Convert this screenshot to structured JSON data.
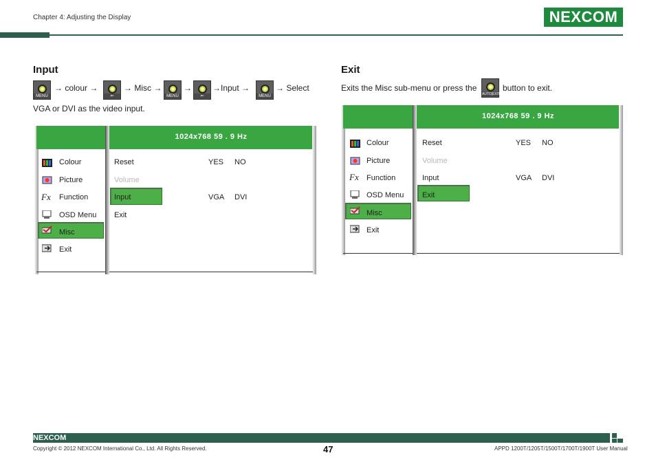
{
  "header": {
    "chapter": "Chapter 4: Adjusting the Display",
    "logo_text": "NEXCOM"
  },
  "input_section": {
    "title": "Input",
    "steps": [
      "→ colour →",
      "→ Misc →",
      "→",
      "→Input →",
      "→ Select"
    ],
    "buttons": [
      "MENU",
      "",
      "MENU",
      "",
      "MENU"
    ],
    "line2": "VGA or DVI as the video input."
  },
  "exit_section": {
    "title": "Exit",
    "desc_before": "Exits the Misc sub-menu or press the",
    "button_caption": "AUTO|EXIT",
    "desc_after": "button to exit."
  },
  "osd": {
    "resolution": "1024x768  59  . 9 Hz",
    "left_items": [
      {
        "label": "Colour",
        "icon": "colour-bars-icon"
      },
      {
        "label": "Picture",
        "icon": "picture-icon"
      },
      {
        "label": "Function",
        "icon": "function-fx-icon"
      },
      {
        "label": "OSD Menu",
        "icon": "osd-menu-icon"
      },
      {
        "label": "Misc",
        "icon": "misc-icon"
      },
      {
        "label": "Exit",
        "icon": "exit-icon"
      }
    ],
    "right_items": [
      {
        "label": "Reset",
        "opt1": "YES",
        "opt2": "NO"
      },
      {
        "label": "Volume",
        "opt1": "",
        "opt2": ""
      },
      {
        "label": "Input",
        "opt1": "VGA",
        "opt2": "DVI"
      },
      {
        "label": "Exit",
        "opt1": "",
        "opt2": ""
      }
    ]
  },
  "footer": {
    "logo_text": "NEXCOM",
    "copyright": "Copyright © 2012 NEXCOM International Co., Ltd. All Rights Reserved.",
    "page": "47",
    "manual": "APPD 1200T/1205T/1500T/1700T/1900T User Manual"
  },
  "colors": {
    "brand_green": "#1e8a3e",
    "osd_green": "#3aa641",
    "footer_bar": "#2d5f4e"
  }
}
